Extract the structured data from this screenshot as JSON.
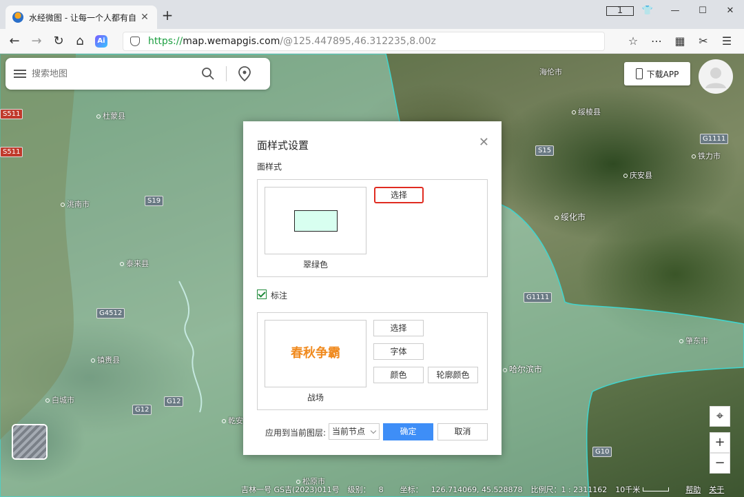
{
  "browser": {
    "tab_title": "水经微图 - 让每一个人都有自",
    "tab_close": "✕",
    "new_tab": "+",
    "window_controls": [
      "1",
      "👕",
      "—",
      "☐",
      "✕"
    ],
    "url_scheme": "https://",
    "url_host": "map.wemapgis.com",
    "url_path": "/@125.447895,46.312235,8.00z",
    "ai_label": "Ai"
  },
  "search": {
    "placeholder": "搜索地图"
  },
  "header": {
    "download_label": "下载APP"
  },
  "map": {
    "colors": {
      "overlay_fill": "#a8f0dc",
      "overlay_stroke": "#3fd6d0"
    },
    "roads": [
      "S511",
      "S511",
      "S19",
      "S15",
      "G1111",
      "G1111",
      "G4512",
      "G12",
      "G12",
      "G10"
    ],
    "places": [
      "海伦市",
      "绥棱县",
      "铁力市",
      "庆安县",
      "绥化市",
      "哈尔滨市",
      "白城市",
      "镇赉县",
      "泰来县",
      "洮南市",
      "杜蒙县",
      "肇东市",
      "乾安县",
      "松原市"
    ]
  },
  "dialog": {
    "title": "面样式设置",
    "close": "✕",
    "fill_section": "面样式",
    "select_btn": "选择",
    "fill_caption": "翠绿色",
    "fill_color": "#d8fff0",
    "label_section": "标注",
    "label_checked": true,
    "label_preview_text": "春秋争霸",
    "label_select_btn": "选择",
    "font_btn": "字体",
    "color_btn": "颜色",
    "outline_color_btn": "轮廓颜色",
    "label_caption": "战场",
    "apply_label": "应用到当前图层:",
    "apply_option": "当前节点",
    "ok_btn": "确定",
    "cancel_btn": "取消"
  },
  "status": {
    "source": "吉林一号 GS吉(2023)011号",
    "level_label": "级别：",
    "level": "8",
    "coord_label": "坐标：",
    "coords": "126.714069, 45.528878",
    "scale_label": "比例尺：1 : 2311162",
    "scale_bar": "10千米",
    "help": "帮助",
    "about": "关于"
  }
}
